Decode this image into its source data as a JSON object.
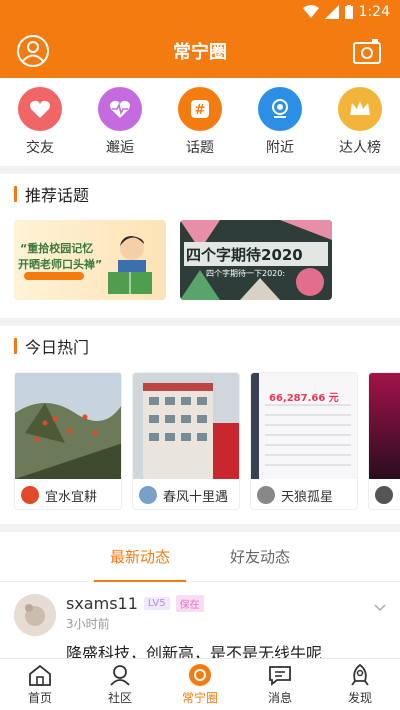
{
  "status": {
    "time": "1:24"
  },
  "header": {
    "title": "常宁圈"
  },
  "quicknav": [
    {
      "label": "交友",
      "icon": "heart-icon",
      "color": "#f06565"
    },
    {
      "label": "邂逅",
      "icon": "heartbeat-icon",
      "color": "#c46be0"
    },
    {
      "label": "话题",
      "icon": "hashtag-icon",
      "color": "#f47b10"
    },
    {
      "label": "附近",
      "icon": "location-icon",
      "color": "#2b8fe6"
    },
    {
      "label": "达人榜",
      "icon": "crown-icon",
      "color": "#f3b43a"
    }
  ],
  "topics": {
    "title": "推荐话题",
    "cards": [
      {
        "headline": "“重拾校园记忆",
        "headline2": "开晒老师口头禅”"
      },
      {
        "headline": "四个字期待2020",
        "sub": "四个字期待一下2020:"
      }
    ]
  },
  "hot": {
    "title": "今日热门",
    "items": [
      {
        "user": "宜水宜耕"
      },
      {
        "user": "春风十里遇"
      },
      {
        "user": "天狼孤星",
        "amount": "66,287.66 元"
      }
    ]
  },
  "tabs": [
    {
      "label": "最新动态",
      "active": true
    },
    {
      "label": "好友动态",
      "active": false
    }
  ],
  "post": {
    "username": "sxams11",
    "level": "LV5",
    "role": "保在",
    "time": "3小时前",
    "text": "降盛科技，创新高，是不是无线牛呢"
  },
  "bottomnav": [
    {
      "label": "首页",
      "icon": "home-icon"
    },
    {
      "label": "社区",
      "icon": "community-icon"
    },
    {
      "label": "常宁圈",
      "icon": "circle-icon",
      "active": true
    },
    {
      "label": "消息",
      "icon": "message-icon"
    },
    {
      "label": "发现",
      "icon": "rocket-icon"
    }
  ],
  "colors": {
    "accent": "#f47b10"
  }
}
